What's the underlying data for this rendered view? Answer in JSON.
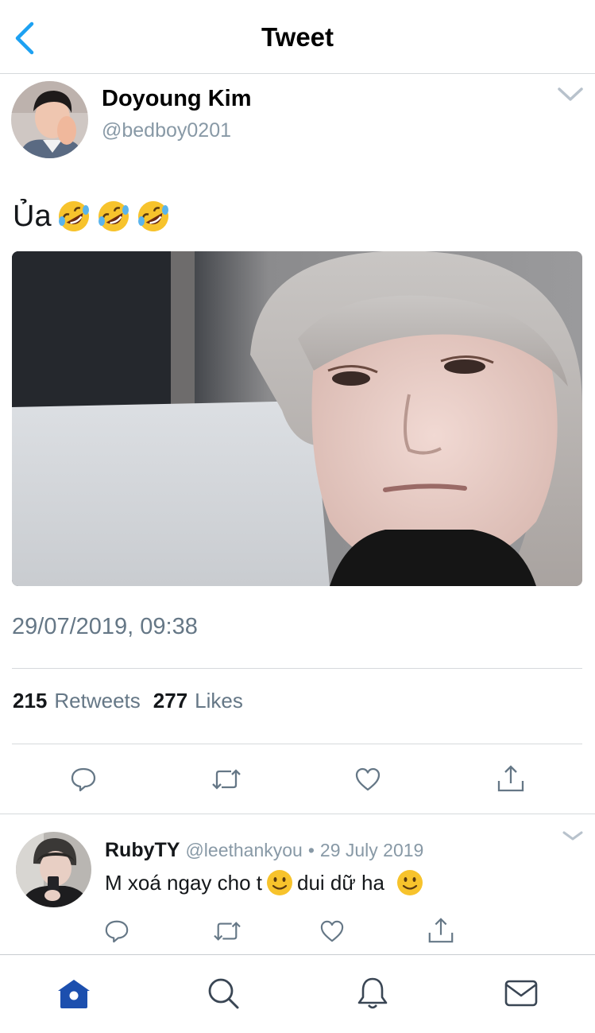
{
  "header": {
    "title": "Tweet"
  },
  "tweet": {
    "author_name": "Doyoung Kim",
    "author_handle": "@bedboy0201",
    "text": "Ủa",
    "text_emoji": "rolling-on-floor-laughing",
    "timestamp": "29/07/2019, 09:38",
    "retweets_count": "215",
    "retweets_label": "Retweets",
    "likes_count": "277",
    "likes_label": "Likes"
  },
  "reply": {
    "author_name": "RubyTY",
    "author_handle": "@leethankyou",
    "separator": "•",
    "date": "29 July 2019",
    "text_part1": "M xoá ngay cho t",
    "text_part2": "dui dữ ha"
  },
  "icons": {
    "back": "chevron-left-icon",
    "menu": "chevron-down-icon",
    "reply": "comment-icon",
    "retweet": "retweet-icon",
    "like": "heart-icon",
    "share": "share-icon",
    "tab_home": "home-icon",
    "tab_search": "search-icon",
    "tab_notifications": "bell-icon",
    "tab_messages": "mail-icon"
  },
  "colors": {
    "accent": "#1da1f2",
    "tab_active": "#1c4fae",
    "secondary_text": "#657786",
    "divider": "#d6d9dc"
  }
}
